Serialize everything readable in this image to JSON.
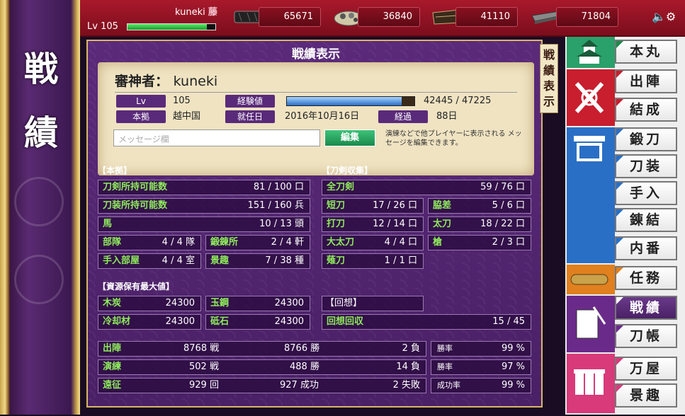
{
  "sidebar": {
    "char1": "戦",
    "char2": "績"
  },
  "topbar": {
    "username": "kuneki",
    "crest": "藤",
    "level_label": "Lv",
    "level": "105",
    "level_fill_percent": 90,
    "resources": [
      "65671",
      "36840",
      "41110",
      "71804"
    ],
    "volume_icon": "🔈⚙"
  },
  "panel": {
    "title": "戦績表示",
    "side_title": "戦績表示",
    "saniwa_label": "審神者：",
    "saniwa_name": "kuneki",
    "lv_label": "Lv",
    "lv_value": "105",
    "exp_label": "経験値",
    "exp_value": "42445 / 47225",
    "exp_fill_percent": 90,
    "base_label": "本拠",
    "base_value": "越中国",
    "start_label": "就任日",
    "start_value": "2016年10月16日",
    "elapsed_label": "経過",
    "elapsed_value": "88日",
    "message_placeholder": "メッセージ欄",
    "edit_button": "編集",
    "edit_help": "演練などで他プレイヤーに表示される メッセージを編集できます。"
  },
  "base": {
    "header": "【本拠】",
    "rows": [
      {
        "k": "刀剣所持可能数",
        "v": "81 / 100 口"
      },
      {
        "k": "刀装所持可能数",
        "v": "151 / 160 兵"
      },
      {
        "k": "馬",
        "v": "10 / 13 頭"
      }
    ],
    "pairs": [
      {
        "k1": "部隊",
        "v1": "4 / 4 隊",
        "k2": "鍛錬所",
        "v2": "2 / 4 軒"
      },
      {
        "k1": "手入部屋",
        "v1": "4 / 4 室",
        "k2": "景趣",
        "v2": "7 / 38 種"
      }
    ]
  },
  "collection": {
    "header": "【刀剣収集】",
    "all": {
      "k": "全刀剣",
      "v": "59 / 76 口"
    },
    "pairs": [
      {
        "k1": "短刀",
        "v1": "17 / 26 口",
        "k2": "脇差",
        "v2": "5 / 6 口"
      },
      {
        "k1": "打刀",
        "v1": "12 / 14 口",
        "k2": "太刀",
        "v2": "18 / 22 口"
      },
      {
        "k1": "大太刀",
        "v1": "4 / 4 口",
        "k2": "槍",
        "v2": "2 / 3 口"
      }
    ],
    "single": {
      "k": "薙刀",
      "v": "1 / 1 口"
    }
  },
  "resources_max": {
    "header": "【資源保有最大値】",
    "pairs": [
      {
        "k1": "木炭",
        "v1": "24300",
        "k2": "玉鋼",
        "v2": "24300"
      },
      {
        "k1": "冷却材",
        "v1": "24300",
        "k2": "砥石",
        "v2": "24300"
      }
    ]
  },
  "recall": {
    "header": "【回想】",
    "row": {
      "k": "回想回収",
      "v": "15 / 45"
    }
  },
  "battle": {
    "rows": [
      {
        "k": "出陣",
        "a": "8768 戦",
        "b": "8766 勝",
        "c": "2 負",
        "rk": "勝率",
        "rv": "99 %"
      },
      {
        "k": "演練",
        "a": "502 戦",
        "b": "488 勝",
        "c": "14 負",
        "rk": "勝率",
        "rv": "97 %"
      },
      {
        "k": "遠征",
        "a": "929 回",
        "b": "927 成功",
        "c": "2 失敗",
        "rk": "成功率",
        "rv": "99 %"
      }
    ]
  },
  "nav": {
    "items": [
      "本丸",
      "出陣",
      "結成",
      "鍛刀",
      "刀装",
      "手入",
      "錬結",
      "内番",
      "任務",
      "戦績",
      "刀帳",
      "万屋",
      "景趣"
    ]
  }
}
